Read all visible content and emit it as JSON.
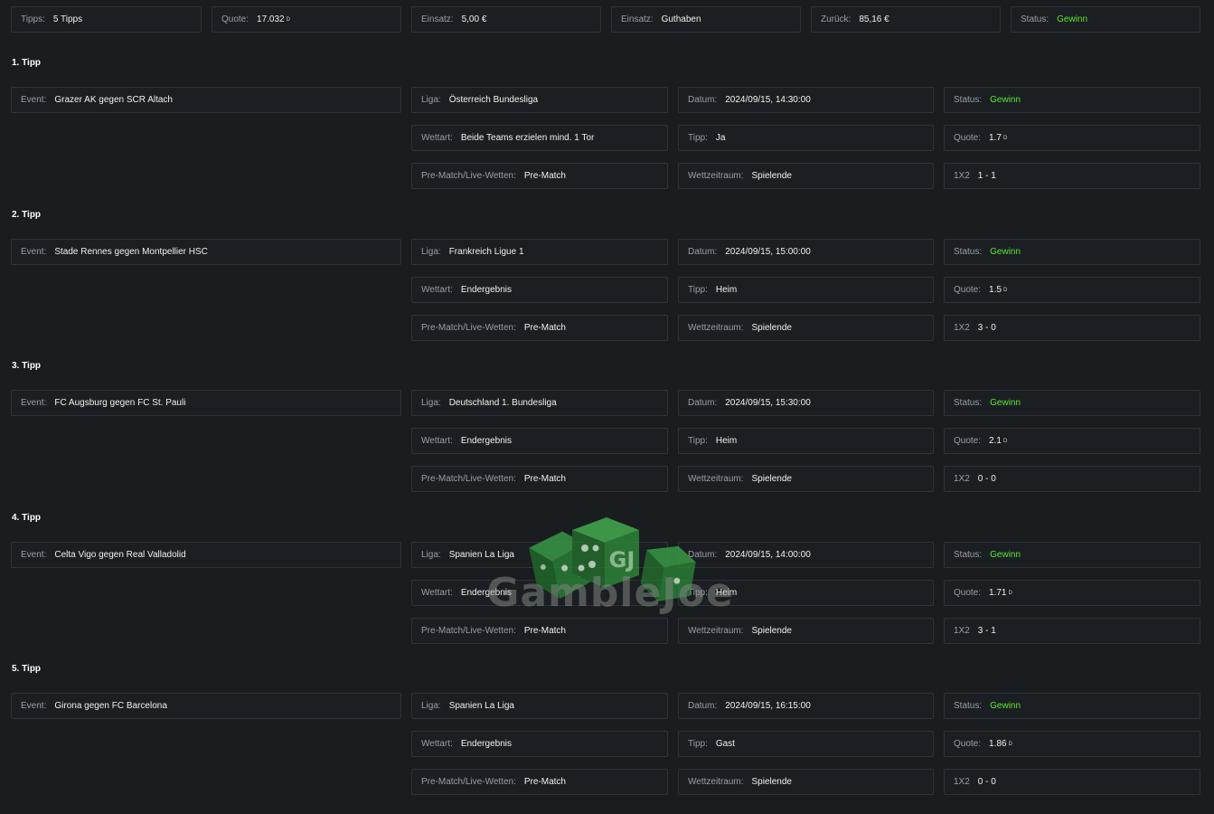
{
  "summary": [
    {
      "label": "Tipps:",
      "value": "5 Tipps"
    },
    {
      "label": "Quote:",
      "value": "17.032",
      "sup": "D"
    },
    {
      "label": "Einsatz:",
      "value": "5,00 €"
    },
    {
      "label": "Einsatz:",
      "value": "Guthaben"
    },
    {
      "label": "Zurück:",
      "value": "85,16 €"
    },
    {
      "label": "Status:",
      "value": "Gewinn",
      "win": true
    }
  ],
  "tipps": [
    {
      "heading": "1. Tipp",
      "event_label": "Event:",
      "event": "Grazer AK gegen SCR Altach",
      "liga_label": "Liga:",
      "liga": "Österreich Bundesliga",
      "datum_label": "Datum:",
      "datum": "2024/09/15, 14:30:00",
      "status_label": "Status:",
      "status": "Gewinn",
      "wettart_label": "Wettart:",
      "wettart": "Beide Teams erzielen mind. 1 Tor",
      "tipp_label": "Tipp:",
      "tipp": "Ja",
      "quote_label": "Quote:",
      "quote": "1.7",
      "quote_sup": "D",
      "prematch_label": "Pre-Match/Live-Wetten:",
      "prematch": "Pre-Match",
      "zeitraum_label": "Wettzeitraum:",
      "zeitraum": "Spielende",
      "x12_label": "1X2",
      "x12": "1 - 1"
    },
    {
      "heading": "2. Tipp",
      "event_label": "Event:",
      "event": "Stade Rennes gegen Montpellier HSC",
      "liga_label": "Liga:",
      "liga": "Frankreich Ligue 1",
      "datum_label": "Datum:",
      "datum": "2024/09/15, 15:00:00",
      "status_label": "Status:",
      "status": "Gewinn",
      "wettart_label": "Wettart:",
      "wettart": "Endergebnis",
      "tipp_label": "Tipp:",
      "tipp": "Heim",
      "quote_label": "Quote:",
      "quote": "1.5",
      "quote_sup": "D",
      "prematch_label": "Pre-Match/Live-Wetten:",
      "prematch": "Pre-Match",
      "zeitraum_label": "Wettzeitraum:",
      "zeitraum": "Spielende",
      "x12_label": "1X2",
      "x12": "3 - 0"
    },
    {
      "heading": "3. Tipp",
      "event_label": "Event:",
      "event": "FC Augsburg gegen FC St. Pauli",
      "liga_label": "Liga:",
      "liga": "Deutschland 1. Bundesliga",
      "datum_label": "Datum:",
      "datum": "2024/09/15, 15:30:00",
      "status_label": "Status:",
      "status": "Gewinn",
      "wettart_label": "Wettart:",
      "wettart": "Endergebnis",
      "tipp_label": "Tipp:",
      "tipp": "Heim",
      "quote_label": "Quote:",
      "quote": "2.1",
      "quote_sup": "D",
      "prematch_label": "Pre-Match/Live-Wetten:",
      "prematch": "Pre-Match",
      "zeitraum_label": "Wettzeitraum:",
      "zeitraum": "Spielende",
      "x12_label": "1X2",
      "x12": "0 - 0"
    },
    {
      "heading": "4. Tipp",
      "event_label": "Event:",
      "event": "Celta Vigo gegen Real Valladolid",
      "liga_label": "Liga:",
      "liga": "Spanien La Liga",
      "datum_label": "Datum:",
      "datum": "2024/09/15, 14:00:00",
      "status_label": "Status:",
      "status": "Gewinn",
      "wettart_label": "Wettart:",
      "wettart": "Endergebnis",
      "tipp_label": "Tipp:",
      "tipp": "Heim",
      "quote_label": "Quote:",
      "quote": "1.71",
      "quote_sup": "D",
      "prematch_label": "Pre-Match/Live-Wetten:",
      "prematch": "Pre-Match",
      "zeitraum_label": "Wettzeitraum:",
      "zeitraum": "Spielende",
      "x12_label": "1X2",
      "x12": "3 - 1"
    },
    {
      "heading": "5. Tipp",
      "event_label": "Event:",
      "event": "Girona gegen FC Barcelona",
      "liga_label": "Liga:",
      "liga": "Spanien La Liga",
      "datum_label": "Datum:",
      "datum": "2024/09/15, 16:15:00",
      "status_label": "Status:",
      "status": "Gewinn",
      "wettart_label": "Wettart:",
      "wettart": "Endergebnis",
      "tipp_label": "Tipp:",
      "tipp": "Gast",
      "quote_label": "Quote:",
      "quote": "1.86",
      "quote_sup": "D",
      "prematch_label": "Pre-Match/Live-Wetten:",
      "prematch": "Pre-Match",
      "zeitraum_label": "Wettzeitraum:",
      "zeitraum": "Spielende",
      "x12_label": "1X2",
      "x12": "0 - 0"
    }
  ],
  "watermark": {
    "text": "GambleJoe",
    "badge": "GJ"
  },
  "colors": {
    "win": "#5bea2f",
    "background": "#1a1d20",
    "dice": "#2f8a3a"
  }
}
